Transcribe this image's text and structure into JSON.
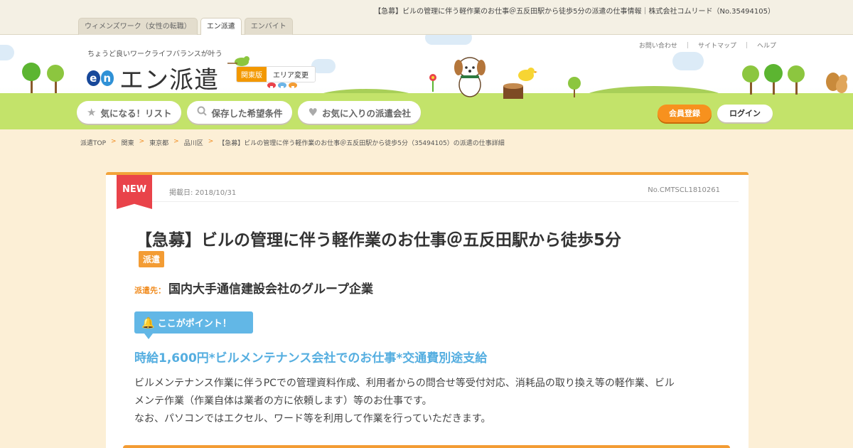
{
  "page_title": "【急募】ビルの管理に伴う軽作業のお仕事＠五反田駅から徒歩5分の派遣の仕事情報｜株式会社コムリード（No.35494105）",
  "site_tabs": [
    {
      "label": "ウィメンズワーク（女性の転職）"
    },
    {
      "label": "エン派遣"
    },
    {
      "label": "エンバイト"
    }
  ],
  "header": {
    "tagline": "ちょうど良いワークライフバランスが叶う",
    "logo_text": "エン派遣",
    "logo_mark": [
      "e",
      "n"
    ],
    "area_region": "関東版",
    "area_change": "エリア変更",
    "util_links": [
      "お問い合わせ",
      "サイトマップ",
      "ヘルプ"
    ],
    "util_sep": "｜"
  },
  "nav": {
    "items": [
      {
        "label": "気になる！リスト",
        "icon": "star-icon"
      },
      {
        "label": "保存した希望条件",
        "icon": "search-icon"
      },
      {
        "label": "お気に入りの派遣会社",
        "icon": "heart-icon"
      }
    ],
    "register": "会員登録",
    "login": "ログイン"
  },
  "breadcrumb": {
    "items": [
      "派遣TOP",
      "関東",
      "東京都",
      "品川区",
      "【急募】ビルの管理に伴う軽作業のお仕事＠五反田駅から徒歩5分（35494105）の派遣の仕事詳細"
    ],
    "sep": ">"
  },
  "job": {
    "new_badge": "NEW",
    "post_date": "掲載日: 2018/10/31",
    "job_no": "No.CMTSCL1810261",
    "title": "【急募】ビルの管理に伴う軽作業のお仕事＠五反田駅から徒歩5分",
    "type": "派遣",
    "dest_label": "派遣先：",
    "dest_value": "国内大手通信建設会社のグループ企業",
    "point_label": "ここがポイント！",
    "catch": "時給1,600円*ビルメンテナンス会社でのお仕事*交通費別途支給",
    "desc_lines": [
      "ビルメンテナンス作業に伴うPCでの管理資料作成、利用者からの問合せ等受付対応、消耗品の取り換え等の軽作業、ビル",
      "メンテ作業（作業自体は業者の方に依頼します）等のお仕事です。",
      "なお、パソコンではエクセル、ワード等を利用して作業を行っていただきます。"
    ]
  },
  "colors": {
    "accent_orange": "#f39800",
    "new_red": "#e9434a",
    "point_blue": "#62b7e6",
    "logo_navy": "#17489a"
  }
}
